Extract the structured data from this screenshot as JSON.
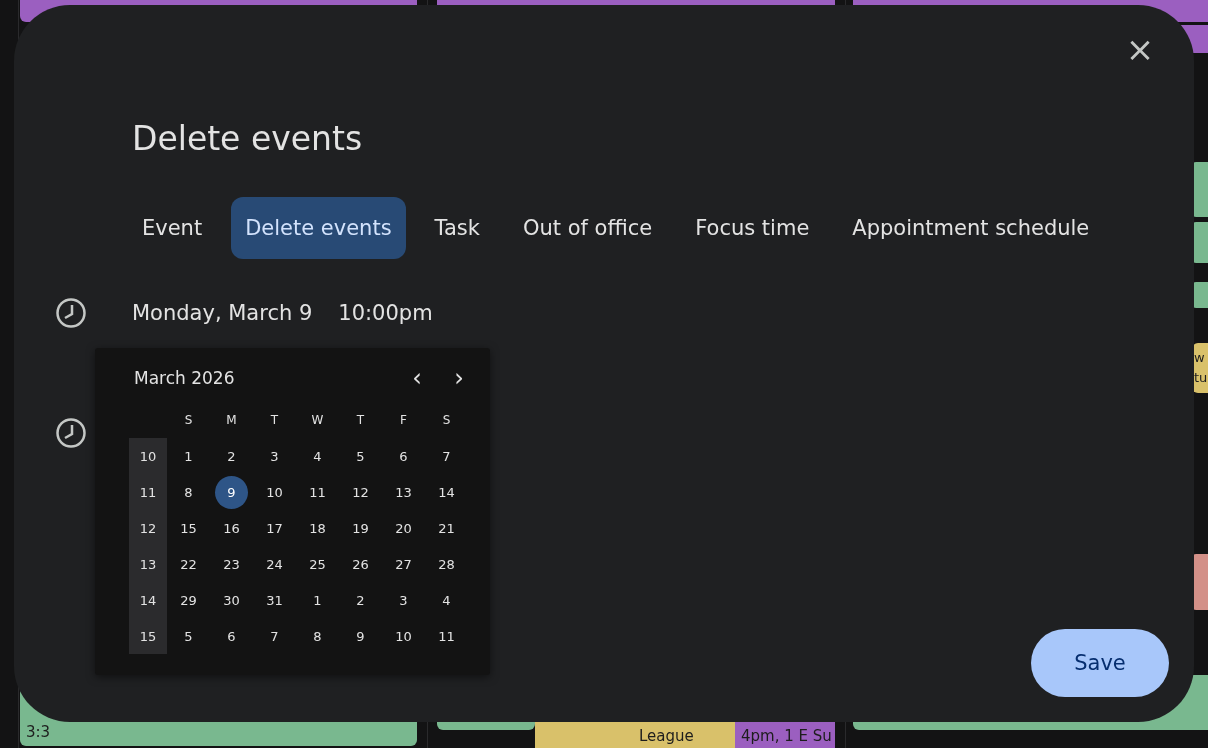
{
  "background_events": [
    {
      "color": "#9b5fc0"
    },
    {
      "color": "#9b5fc0"
    },
    {
      "color": "#9b5fc0"
    },
    {
      "color": "#9b5fc0"
    },
    {
      "color": "#79b88f"
    },
    {
      "color": "#79b88f"
    },
    {
      "color": "#79b88f"
    },
    {
      "color": "#d9c16a",
      "text": "w",
      "text_2": "tu"
    },
    {
      "color": "#d39088"
    },
    {
      "color": "#79b88f",
      "text": "3:3"
    },
    {
      "color": "#79b88f"
    },
    {
      "color": "#d9c16a"
    },
    {
      "color": "#d9c16a",
      "text": "League"
    },
    {
      "color": "#9b5fc0",
      "text": "4pm, 1 E Su"
    },
    {
      "color": "#79b88f"
    }
  ],
  "dialog": {
    "title": "Delete events",
    "close": "×",
    "tabs": [
      {
        "label": "Event",
        "selected": false
      },
      {
        "label": "Delete events",
        "selected": true
      },
      {
        "label": "Task",
        "selected": false
      },
      {
        "label": "Out of office",
        "selected": false
      },
      {
        "label": "Focus time",
        "selected": false
      },
      {
        "label": "Appointment schedule",
        "selected": false
      }
    ],
    "date": "Monday, March 9",
    "time": "10:00pm",
    "date_picker": {
      "month": "March 2026",
      "prev": "‹",
      "next": "›",
      "weekdays": [
        "S",
        "M",
        "T",
        "W",
        "T",
        "F",
        "S"
      ],
      "weeks": [
        {
          "number": "10",
          "days": [
            {
              "day": "1",
              "selected": false
            },
            {
              "day": "2",
              "selected": false
            },
            {
              "day": "3",
              "selected": false
            },
            {
              "day": "4",
              "selected": false
            },
            {
              "day": "5",
              "selected": false
            },
            {
              "day": "6",
              "selected": false
            },
            {
              "day": "7",
              "selected": false
            }
          ]
        },
        {
          "number": "11",
          "days": [
            {
              "day": "8",
              "selected": false
            },
            {
              "day": "9",
              "selected": true
            },
            {
              "day": "10",
              "selected": false
            },
            {
              "day": "11",
              "selected": false
            },
            {
              "day": "12",
              "selected": false
            },
            {
              "day": "13",
              "selected": false
            },
            {
              "day": "14",
              "selected": false
            }
          ]
        },
        {
          "number": "12",
          "days": [
            {
              "day": "15",
              "selected": false
            },
            {
              "day": "16",
              "selected": false
            },
            {
              "day": "17",
              "selected": false
            },
            {
              "day": "18",
              "selected": false
            },
            {
              "day": "19",
              "selected": false
            },
            {
              "day": "20",
              "selected": false
            },
            {
              "day": "21",
              "selected": false
            }
          ]
        },
        {
          "number": "13",
          "days": [
            {
              "day": "22",
              "selected": false
            },
            {
              "day": "23",
              "selected": false
            },
            {
              "day": "24",
              "selected": false
            },
            {
              "day": "25",
              "selected": false
            },
            {
              "day": "26",
              "selected": false
            },
            {
              "day": "27",
              "selected": false
            },
            {
              "day": "28",
              "selected": false
            }
          ]
        },
        {
          "number": "14",
          "days": [
            {
              "day": "29",
              "selected": false
            },
            {
              "day": "30",
              "selected": false
            },
            {
              "day": "31",
              "selected": false
            },
            {
              "day": "1",
              "selected": false
            },
            {
              "day": "2",
              "selected": false
            },
            {
              "day": "3",
              "selected": false
            },
            {
              "day": "4",
              "selected": false
            }
          ]
        },
        {
          "number": "15",
          "days": [
            {
              "day": "5",
              "selected": false
            },
            {
              "day": "6",
              "selected": false
            },
            {
              "day": "7",
              "selected": false
            },
            {
              "day": "8",
              "selected": false
            },
            {
              "day": "9",
              "selected": false
            },
            {
              "day": "10",
              "selected": false
            },
            {
              "day": "11",
              "selected": false
            }
          ]
        }
      ]
    },
    "save": "Save"
  }
}
